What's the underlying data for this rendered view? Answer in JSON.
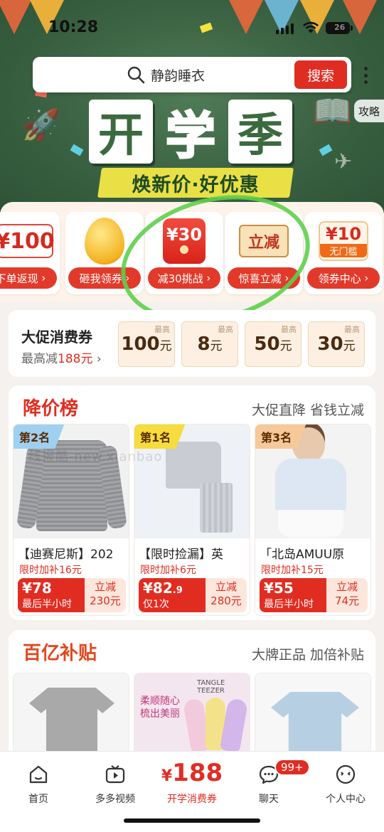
{
  "status_bar": {
    "time": "10:28",
    "battery": "26"
  },
  "search": {
    "query": "静韵睡衣",
    "button_label": "搜索"
  },
  "side_tab": {
    "label": "攻略"
  },
  "banner": {
    "title_chars": [
      "开",
      "学",
      "季"
    ],
    "slogan": "焕新价·好优惠"
  },
  "feature_cards": [
    {
      "icon": "coupon-100-icon",
      "icon_text": "¥100",
      "label": "下单返现"
    },
    {
      "icon": "golden-egg-icon",
      "icon_text": "",
      "label": "砸我领券"
    },
    {
      "icon": "red-packet-icon",
      "icon_text": "¥30",
      "label": "减30挑战"
    },
    {
      "icon": "instant-discount-icon",
      "icon_text": "立减",
      "label": "惊喜立减"
    },
    {
      "icon": "coupon-10-icon",
      "icon_text": "¥10",
      "icon_tag": "无门槛",
      "label": "领券中心"
    }
  ],
  "voucher": {
    "title": "大促消费券",
    "subtitle_prefix": "最高减",
    "subtitle_amount": "188元",
    "chips": [
      {
        "badge": "最高",
        "amount": "100",
        "unit": "元"
      },
      {
        "badge": "最高",
        "amount": "8",
        "unit": "元"
      },
      {
        "badge": "最高",
        "amount": "50",
        "unit": "元"
      },
      {
        "badge": "最高",
        "amount": "30",
        "unit": "元"
      }
    ]
  },
  "price_drop": {
    "title": "降价榜",
    "subtitle": "大促直降 省钱立减",
    "watermark": "线报酷-new.xianbao",
    "products": [
      {
        "rank": "第2名",
        "name": "【迪赛尼斯】202",
        "extra": "限时加补16元",
        "price": "¥78",
        "price_decimal": "",
        "note": "最后半小时",
        "discount_label": "立减",
        "discount": "230元"
      },
      {
        "rank": "第1名",
        "name": "【限时捡漏】英",
        "extra": "限时加补6元",
        "price": "¥82",
        "price_decimal": ".9",
        "note": "仅1次",
        "discount_label": "立减",
        "discount": "280元"
      },
      {
        "rank": "第3名",
        "name": "「北岛AMUU原",
        "extra": "限时加补15元",
        "price": "¥55",
        "price_decimal": "",
        "note": "最后半小时",
        "discount_label": "立减",
        "discount": "74元"
      }
    ]
  },
  "subsidy": {
    "title": "百亿补贴",
    "subtitle": "大牌正品 加倍补贴",
    "promo_brand": "TANGLE TEEZER",
    "promo_text": "柔顺随心 梳出美丽"
  },
  "bottom_nav": [
    {
      "label": "首页"
    },
    {
      "label": "多多视频"
    },
    {
      "label": "开学消费券",
      "amount": "188"
    },
    {
      "label": "聊天",
      "badge": "99+"
    },
    {
      "label": "个人中心"
    }
  ],
  "colors": {
    "brand_red": "#e02d22",
    "banner_green": "#3a6142",
    "annotation_green": "#5fcf4c"
  }
}
